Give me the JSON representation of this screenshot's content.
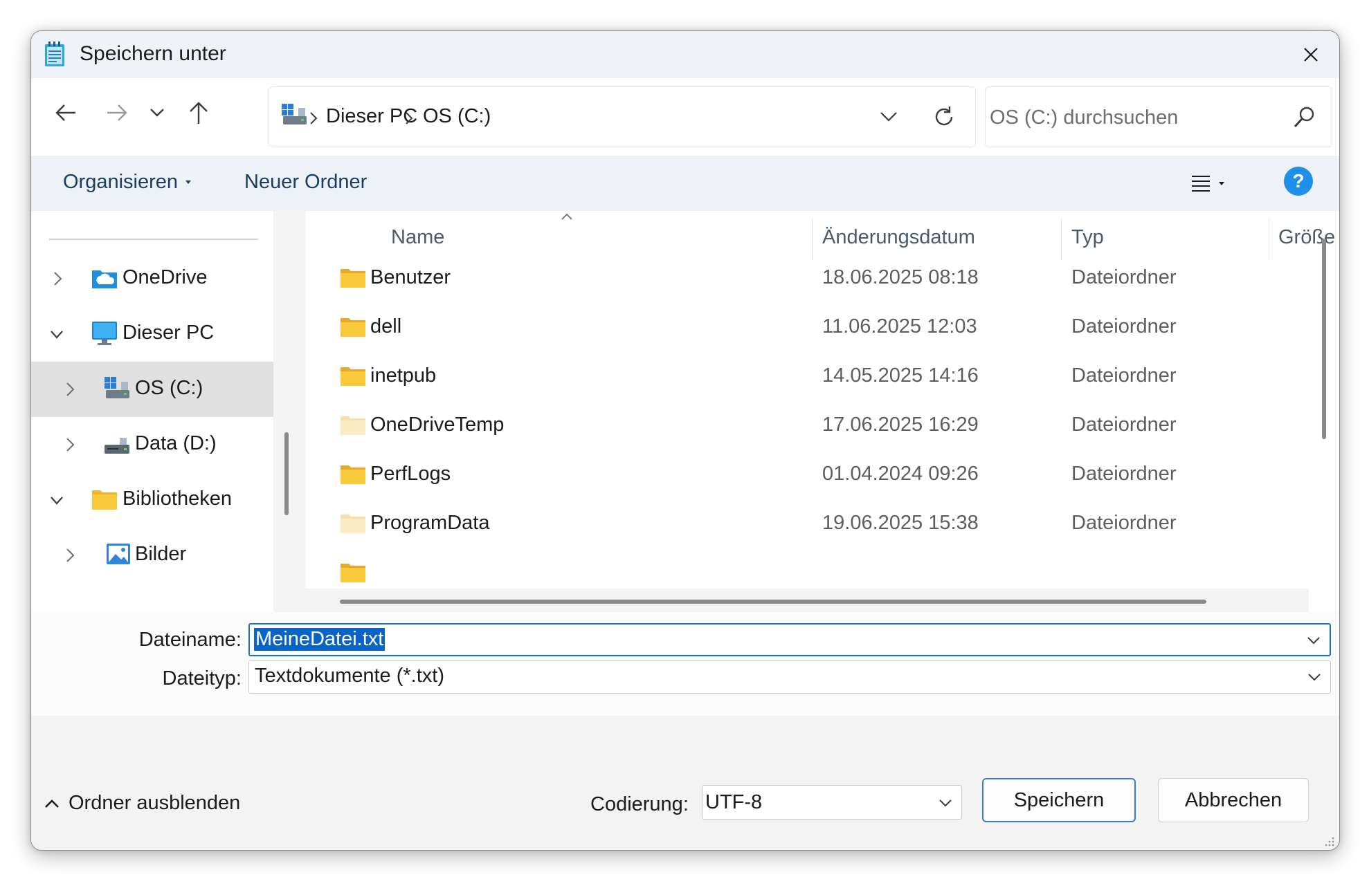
{
  "window": {
    "title": "Speichern unter",
    "app_icon": "notepad-icon"
  },
  "nav": {
    "back_icon": "arrow-left-icon",
    "forward_icon": "arrow-right-icon",
    "recent_icon": "chevron-down-icon",
    "up_icon": "arrow-up-icon"
  },
  "address": {
    "crumbs": [
      "Dieser PC",
      "OS (C:)"
    ],
    "refresh_icon": "refresh-icon"
  },
  "search": {
    "placeholder": "OS (C:) durchsuchen"
  },
  "commands": {
    "organize": "Organisieren",
    "new_folder": "Neuer Ordner",
    "help": "?"
  },
  "sidebar": {
    "items": [
      {
        "label": "OneDrive",
        "expanded": false,
        "icon": "onedrive-icon"
      },
      {
        "label": "Dieser PC",
        "expanded": true,
        "icon": "pc-icon"
      },
      {
        "label": "OS (C:)",
        "expanded": false,
        "icon": "drive-c-icon",
        "selected": true
      },
      {
        "label": "Data (D:)",
        "expanded": false,
        "icon": "drive-d-icon"
      },
      {
        "label": "Bibliotheken",
        "expanded": true,
        "icon": "libraries-icon"
      },
      {
        "label": "Bilder",
        "expanded": false,
        "icon": "pictures-icon"
      }
    ]
  },
  "files": {
    "columns": [
      "Name",
      "Änderungsdatum",
      "Typ",
      "Größe"
    ],
    "rows": [
      {
        "name": "Benutzer",
        "date": "18.06.2025 08:18",
        "type": "Dateiordner"
      },
      {
        "name": "dell",
        "date": "11.06.2025 12:03",
        "type": "Dateiordner"
      },
      {
        "name": "inetpub",
        "date": "14.05.2025 14:16",
        "type": "Dateiordner"
      },
      {
        "name": "OneDriveTemp",
        "date": "17.06.2025 16:29",
        "type": "Dateiordner"
      },
      {
        "name": "PerfLogs",
        "date": "01.04.2024 09:26",
        "type": "Dateiordner"
      },
      {
        "name": "ProgramData",
        "date": "19.06.2025 15:38",
        "type": "Dateiordner"
      }
    ]
  },
  "form": {
    "filename_label": "Dateiname:",
    "filename_value": "MeineDatei.txt",
    "filetype_label": "Dateityp:",
    "filetype_value": "Textdokumente (*.txt)"
  },
  "footer": {
    "hide_folders": "Ordner ausblenden",
    "encoding_label": "Codierung:",
    "encoding_value": "UTF-8",
    "save": "Speichern",
    "cancel": "Abbrechen"
  },
  "colors": {
    "accent": "#1a73c9",
    "selection": "#0a64c8",
    "folder": "#f8c93a",
    "help": "#1e90e8"
  }
}
